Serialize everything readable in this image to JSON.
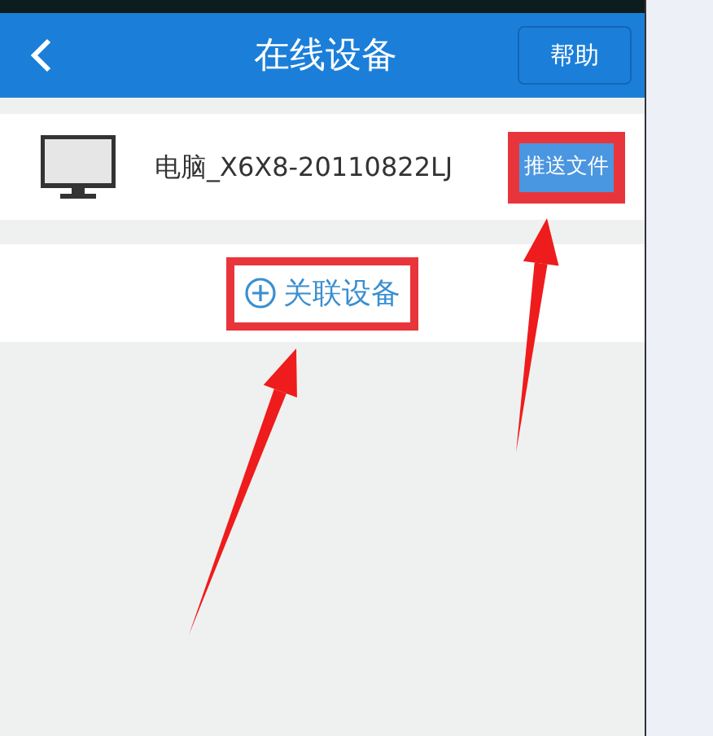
{
  "header": {
    "title": "在线设备",
    "help_button": "帮助"
  },
  "devices": [
    {
      "name": "电脑_X6X8-20110822LJ",
      "action": "推送文件",
      "highlighted": true,
      "arrow": true
    }
  ],
  "link_device": {
    "label": "关联设备",
    "highlighted": true,
    "arrow": true
  }
}
